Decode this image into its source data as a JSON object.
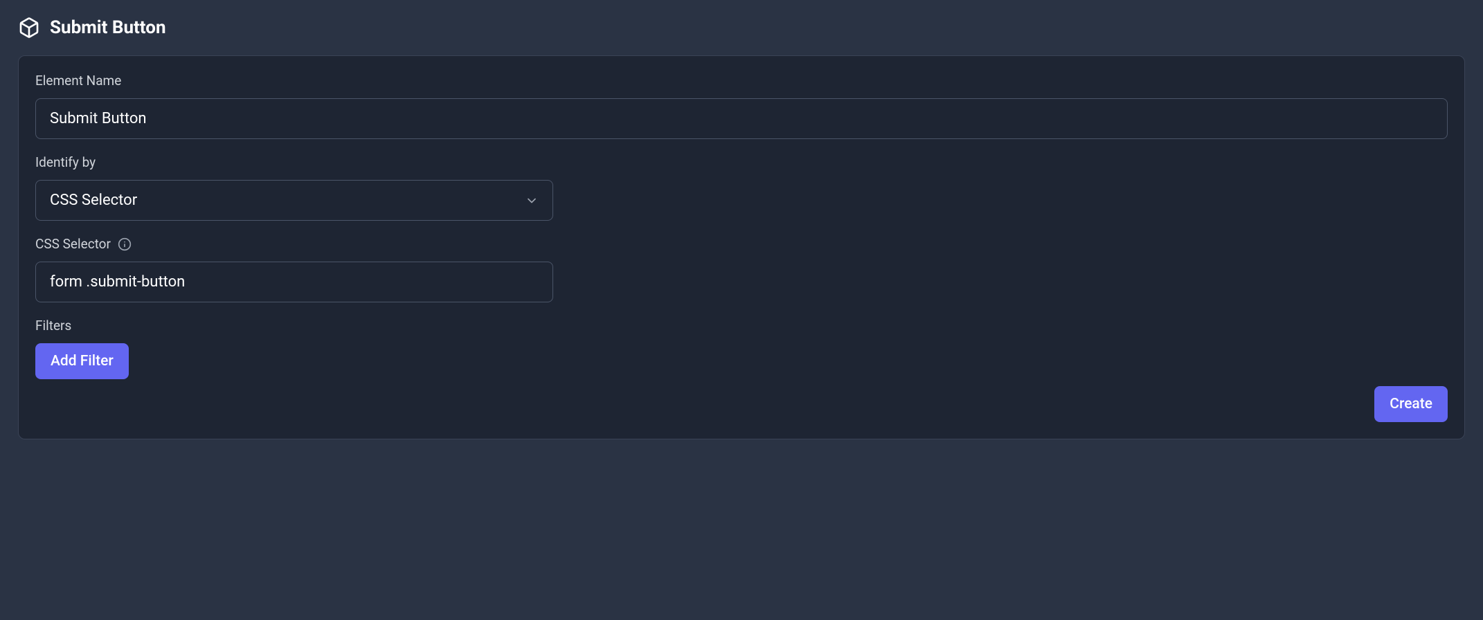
{
  "header": {
    "title": "Submit Button"
  },
  "form": {
    "elementName": {
      "label": "Element Name",
      "value": "Submit Button"
    },
    "identifyBy": {
      "label": "Identify by",
      "selected": "CSS Selector"
    },
    "cssSelector": {
      "label": "CSS Selector",
      "value": "form .submit-button"
    },
    "filters": {
      "label": "Filters",
      "addButton": "Add Filter"
    },
    "createButton": "Create"
  }
}
